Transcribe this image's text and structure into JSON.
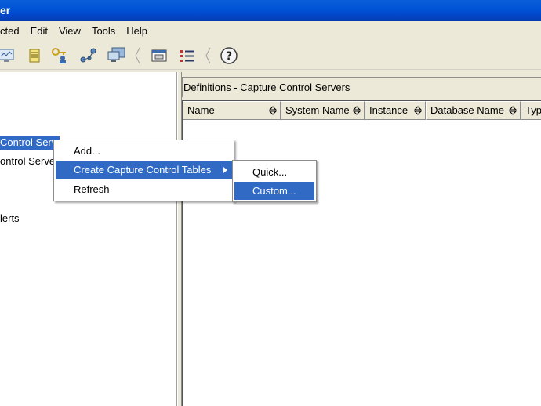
{
  "window": {
    "title_fragment": "er"
  },
  "menubar": {
    "items": [
      "cted",
      "Edit",
      "View",
      "Tools",
      "Help"
    ]
  },
  "toolbar": {
    "icons": [
      "monitor-icon",
      "notes-icon",
      "key-user-icon",
      "network-icon",
      "computer-icon",
      "dialog-icon",
      "list-icon",
      "help-icon"
    ]
  },
  "tree": {
    "items": [
      {
        "label": "Control Serv",
        "selected": true
      },
      {
        "label": "ontrol Serve",
        "selected": false
      },
      {
        "label": "lerts",
        "selected": false
      }
    ]
  },
  "panel": {
    "title": "Definitions - Capture Control Servers",
    "columns": [
      "Name",
      "System Name",
      "Instance",
      "Database Name",
      "Typ"
    ]
  },
  "context_menu": {
    "items": [
      "Add...",
      "Create Capture Control Tables",
      "Refresh"
    ],
    "highlighted": "Create Capture Control Tables"
  },
  "submenu": {
    "items": [
      "Quick...",
      "Custom..."
    ],
    "highlighted": "Custom..."
  },
  "colors": {
    "selection": "#316ac5",
    "titlebar": "#0052d6",
    "chrome": "#ece9d8"
  }
}
